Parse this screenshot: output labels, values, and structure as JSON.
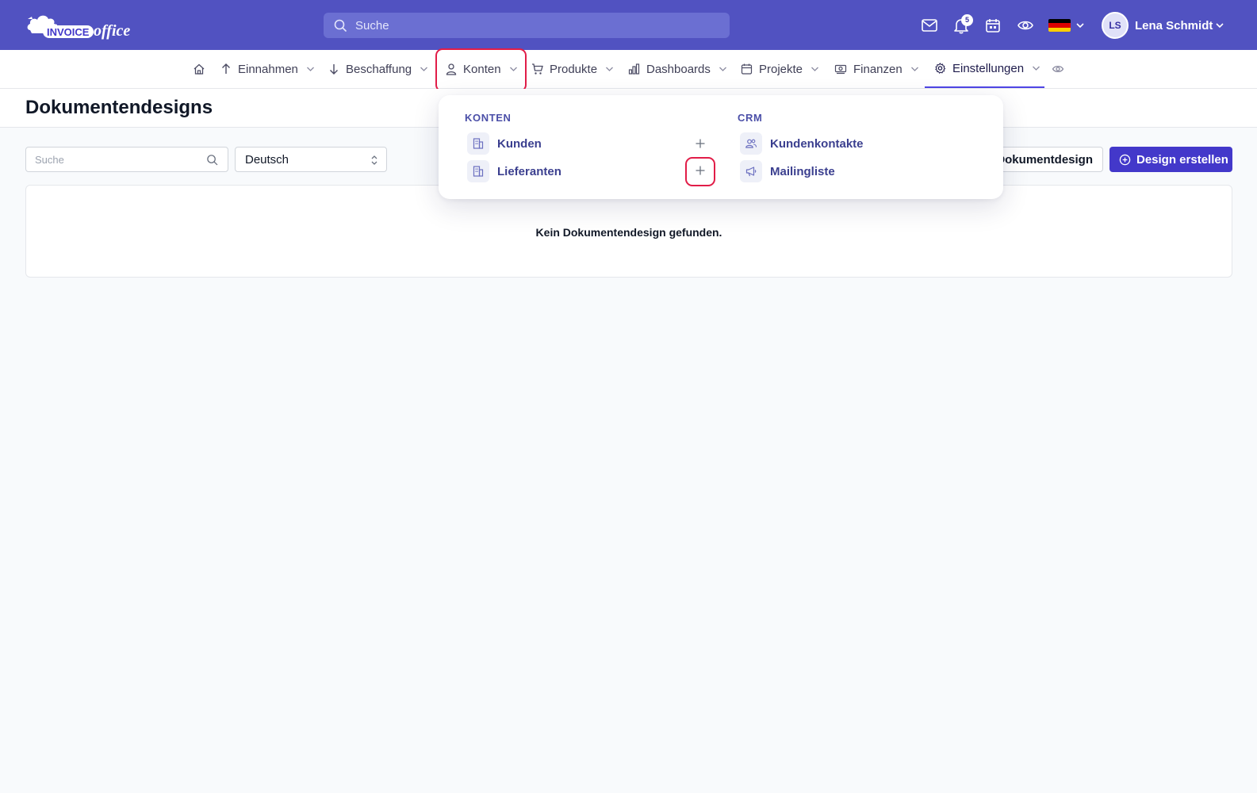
{
  "brand": {
    "logo_text_left": "INVOICE",
    "logo_text_right": "office"
  },
  "topbar": {
    "search_placeholder": "Suche",
    "notifications_count": "5",
    "flag_colors": [
      "#000000",
      "#dd0000",
      "#ffce00"
    ],
    "user": {
      "initials": "LS",
      "name": "Lena Schmidt"
    }
  },
  "nav": {
    "home_icon": "home-icon",
    "items": [
      {
        "label": "Einnahmen",
        "icon": "arrow-up-icon"
      },
      {
        "label": "Beschaffung",
        "icon": "arrow-down-icon"
      },
      {
        "label": "Konten",
        "icon": "user-icon"
      },
      {
        "label": "Produkte",
        "icon": "cart-icon"
      },
      {
        "label": "Dashboards",
        "icon": "bar-chart-icon"
      },
      {
        "label": "Projekte",
        "icon": "calendar-icon"
      },
      {
        "label": "Finanzen",
        "icon": "money-icon"
      },
      {
        "label": "Einstellungen",
        "icon": "gear-icon"
      }
    ]
  },
  "page": {
    "title": "Dokumentendesigns"
  },
  "filters": {
    "search_placeholder": "Suche",
    "language": "Deutsch"
  },
  "actions": {
    "outline_label": "Dokumentdesign",
    "primary_label": "Design erstellen"
  },
  "empty_state": {
    "message": "Kein Dokumentendesign gefunden."
  },
  "dropdown": {
    "konten": {
      "heading": "KONTEN",
      "items": [
        {
          "label": "Kunden",
          "icon": "building-icon"
        },
        {
          "label": "Lieferanten",
          "icon": "building-icon"
        }
      ]
    },
    "crm": {
      "heading": "CRM",
      "items": [
        {
          "label": "Kundenkontakte",
          "icon": "users-icon"
        },
        {
          "label": "Mailingliste",
          "icon": "megaphone-icon"
        }
      ]
    }
  },
  "colors": {
    "topbar": "#5152c1",
    "primary": "#4338ca",
    "highlight": "#e11d48"
  }
}
